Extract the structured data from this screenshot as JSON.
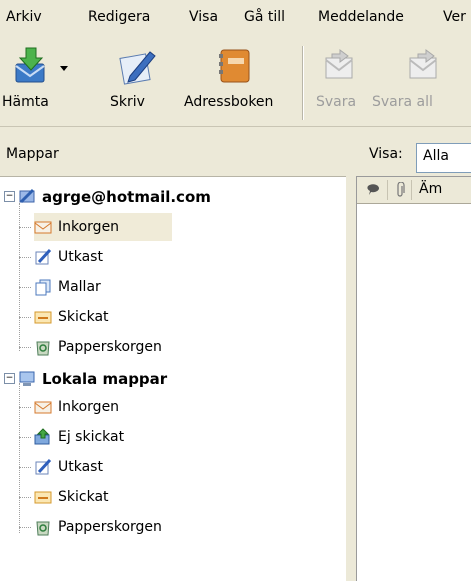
{
  "menubar": {
    "items": [
      {
        "label": "Arkiv"
      },
      {
        "label": "Redigera"
      },
      {
        "label": "Visa"
      },
      {
        "label": "Gå till"
      },
      {
        "label": "Meddelande"
      },
      {
        "label": "Ver"
      }
    ]
  },
  "toolbar": {
    "buttons": [
      {
        "label": "Hämta",
        "icon": "download-mail-icon"
      },
      {
        "label": "Skriv",
        "icon": "compose-icon"
      },
      {
        "label": "Adressboken",
        "icon": "address-book-icon"
      },
      {
        "label": "Svara",
        "icon": "reply-icon"
      },
      {
        "label": "Svara all",
        "icon": "reply-all-icon"
      }
    ]
  },
  "folders_header": {
    "label": "Mappar"
  },
  "view": {
    "label": "Visa:",
    "value": "Alla"
  },
  "messages": {
    "subject_header": "Äm"
  },
  "tree": {
    "account": {
      "label": "agrge@hotmail.com",
      "folders": [
        {
          "label": "Inkorgen"
        },
        {
          "label": "Utkast"
        },
        {
          "label": "Mallar"
        },
        {
          "label": "Skickat"
        },
        {
          "label": "Papperskorgen"
        }
      ]
    },
    "local": {
      "label": "Lokala mappar",
      "folders": [
        {
          "label": "Inkorgen"
        },
        {
          "label": "Ej skickat"
        },
        {
          "label": "Utkast"
        },
        {
          "label": "Skickat"
        },
        {
          "label": "Papperskorgen"
        }
      ]
    }
  },
  "colors": {
    "selected_bg": "#f0ebd8",
    "tree_line": "#a0a0a0"
  }
}
